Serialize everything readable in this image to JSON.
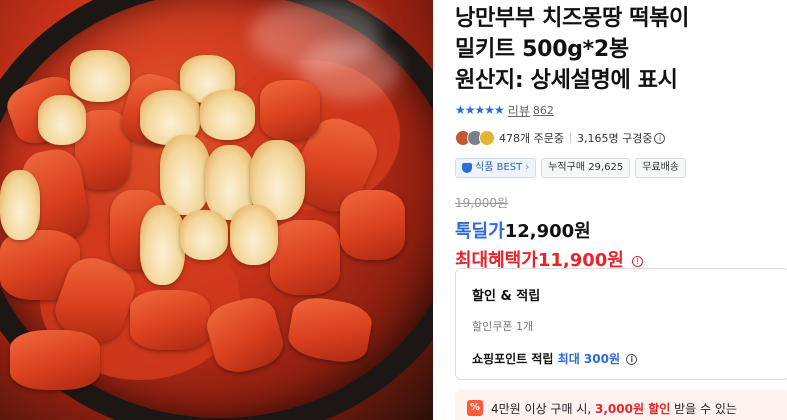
{
  "product": {
    "title_line1": "낭만부부 치즈몽땅 떡볶이",
    "title_line2": "밀키트 500g*2봉",
    "title_line3": "원산지: 상세설명에 표시"
  },
  "rating": {
    "stars": "★★★★★",
    "review_label": "리뷰",
    "review_count": "862"
  },
  "orders": {
    "ordering": "478개 주문중",
    "buyers": "3,165명 구경중",
    "info_icon": "ⓘ"
  },
  "badges": {
    "best": "식품 BEST",
    "best_chevron": "›",
    "cumulative": "누적구매 29,625",
    "delivery": "무료배송"
  },
  "price": {
    "original": "19,000원",
    "deal_label": "톡딜가",
    "deal_price": "12,900원",
    "max_label": "최대혜택가",
    "max_price": "11,900원",
    "max_info_icon": "!"
  },
  "benefit": {
    "title": "할인 & 적립",
    "coupon": "할인쿠폰 1개",
    "point_prefix": "쇼핑포인트 적립",
    "point_max": "최대 300원",
    "point_icon": "ⓘ"
  },
  "promo": {
    "icon_label": "%",
    "text_prefix": "4만원 이상 구매 시,",
    "text_amount": "3,000원 할인",
    "text_suffix": "받을 수 있는"
  },
  "colors": {
    "accent_blue": "#2f6bd8",
    "accent_red": "#e8232b",
    "promo_bg": "#fff2ef"
  }
}
